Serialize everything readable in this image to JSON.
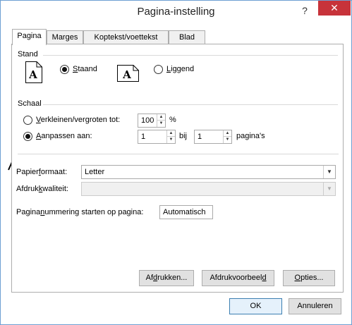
{
  "window": {
    "title": "Pagina-instelling",
    "help_glyph": "?",
    "close_glyph": "✕"
  },
  "tabs": [
    {
      "label": "Pagina",
      "active": true
    },
    {
      "label": "Marges",
      "active": false
    },
    {
      "label": "Koptekst/voettekst",
      "active": false
    },
    {
      "label": "Blad",
      "active": false
    }
  ],
  "stand": {
    "group_label": "Stand",
    "icon_letter": "A",
    "staand_label": "Staand",
    "staand_accel": "S",
    "staand_rest": "taand",
    "liggend_label": "Liggend",
    "liggend_accel": "L",
    "liggend_rest": "iggend",
    "selected": "staand"
  },
  "schaal": {
    "group_label": "Schaal",
    "verkleinen_accel": "V",
    "verkleinen_rest": "erkleinen/vergroten tot:",
    "verkleinen_value": "100",
    "percent_label": "%",
    "aanpassen_accel": "A",
    "aanpassen_rest": "anpassen aan:",
    "pages_wide_value": "1",
    "bij_label": "bij",
    "pages_tall_value": "1",
    "paginas_label": "pagina's",
    "selected": "aanpassen"
  },
  "papierformaat": {
    "label_pre": "Papier",
    "label_accel": "f",
    "label_post": "ormaat:",
    "value": "Letter"
  },
  "afdrukkwaliteit": {
    "label_pre": "Afdruk",
    "label_accel": "k",
    "label_post": "waliteit:",
    "value": ""
  },
  "paginanummering": {
    "label_pre": "Pagina",
    "label_accel": "n",
    "label_post": "ummering starten op pagina:",
    "value": "Automatisch"
  },
  "buttons": {
    "afdrukken_pre": "Af",
    "afdrukken_accel": "d",
    "afdrukken_post": "rukken...",
    "voorbeeld_pre": "Afdrukvoorbeel",
    "voorbeeld_accel": "d",
    "voorbeeld_post": "",
    "opties_pre": "",
    "opties_accel": "O",
    "opties_post": "pties...",
    "ok": "OK",
    "annuleren": "Annuleren"
  },
  "colors": {
    "close_bg": "#c7333a",
    "window_border": "#6d9fd3",
    "default_button_border": "#3c7fb1"
  }
}
